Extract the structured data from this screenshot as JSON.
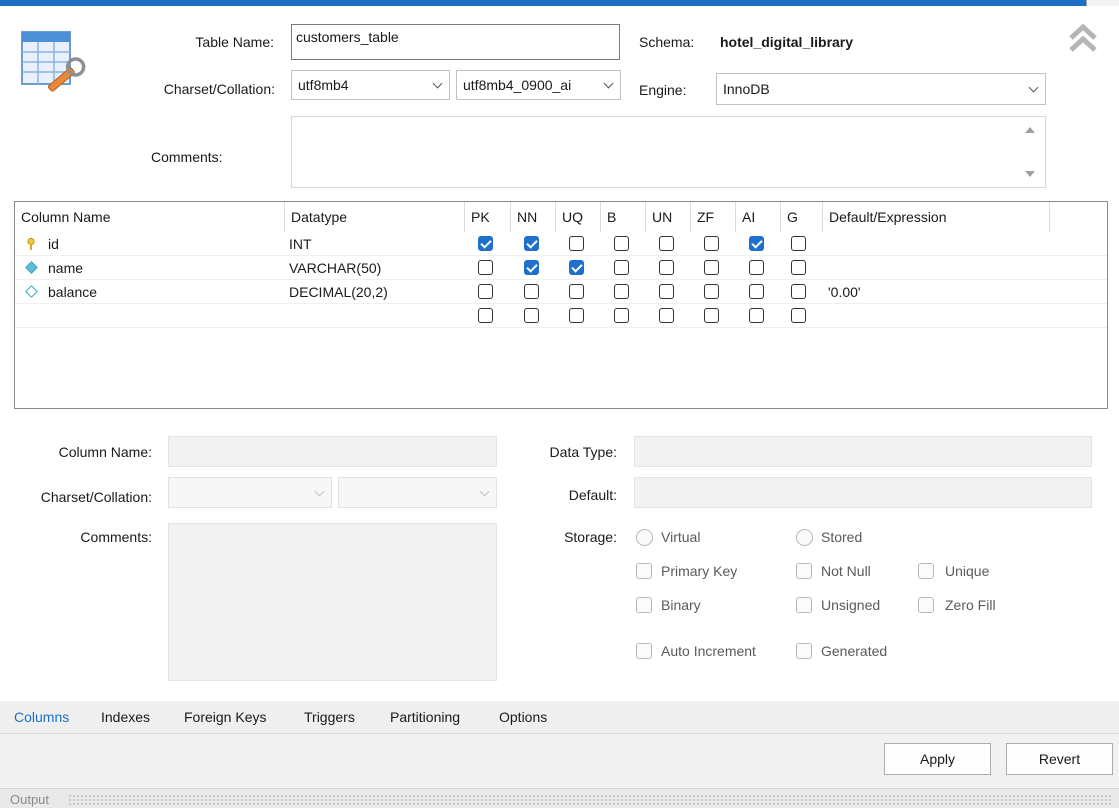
{
  "header": {
    "table_name_label": "Table Name:",
    "table_name_value": "customers_table",
    "schema_label": "Schema:",
    "schema_value": "hotel_digital_library",
    "charset_label": "Charset/Collation:",
    "charset_value": "utf8mb4",
    "collation_value": "utf8mb4_0900_ai",
    "engine_label": "Engine:",
    "engine_value": "InnoDB",
    "comments_label": "Comments:"
  },
  "columns_grid": {
    "headers": [
      "Column Name",
      "Datatype",
      "PK",
      "NN",
      "UQ",
      "B",
      "UN",
      "ZF",
      "AI",
      "G",
      "Default/Expression"
    ],
    "rows": [
      {
        "name": "id",
        "icon": "primary-key-icon",
        "datatype": "INT",
        "flags": [
          true,
          true,
          false,
          false,
          false,
          false,
          true,
          false
        ],
        "default": ""
      },
      {
        "name": "name",
        "icon": "column-filled-diamond-icon",
        "datatype": "VARCHAR(50)",
        "flags": [
          false,
          true,
          true,
          false,
          false,
          false,
          false,
          false
        ],
        "default": ""
      },
      {
        "name": "balance",
        "icon": "column-diamond-icon",
        "datatype": "DECIMAL(20,2)",
        "flags": [
          false,
          false,
          false,
          false,
          false,
          false,
          false,
          false
        ],
        "default": "'0.00'"
      },
      {
        "name": "",
        "icon": "",
        "datatype": "",
        "flags": [
          false,
          false,
          false,
          false,
          false,
          false,
          false,
          false
        ],
        "default": ""
      }
    ]
  },
  "details": {
    "column_name_label": "Column Name:",
    "charset_label": "Charset/Collation:",
    "comments_label": "Comments:",
    "data_type_label": "Data Type:",
    "default_label": "Default:",
    "storage_label": "Storage:",
    "virtual_label": "Virtual",
    "stored_label": "Stored",
    "primary_key_label": "Primary Key",
    "not_null_label": "Not Null",
    "unique_label": "Unique",
    "binary_label": "Binary",
    "unsigned_label": "Unsigned",
    "zero_fill_label": "Zero Fill",
    "auto_increment_label": "Auto Increment",
    "generated_label": "Generated"
  },
  "tabs": [
    {
      "label": "Columns",
      "active": true
    },
    {
      "label": "Indexes",
      "active": false
    },
    {
      "label": "Foreign Keys",
      "active": false
    },
    {
      "label": "Triggers",
      "active": false
    },
    {
      "label": "Partitioning",
      "active": false
    },
    {
      "label": "Options",
      "active": false
    }
  ],
  "buttons": {
    "apply": "Apply",
    "revert": "Revert"
  },
  "output": {
    "label": "Output"
  },
  "colors": {
    "accent": "#1c6fc4",
    "checked": "#1f6fcc"
  }
}
